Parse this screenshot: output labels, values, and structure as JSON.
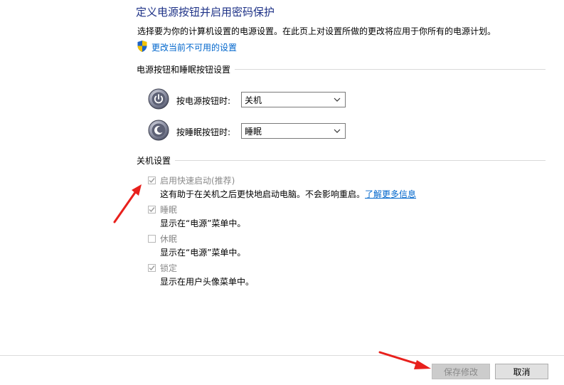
{
  "header": {
    "title": "定义电源按钮并启用密码保护",
    "description": "选择要为你的计算机设置的电源设置。在此页上对设置所做的更改将应用于你所有的电源计划。",
    "change_link": "更改当前不可用的设置",
    "shield_icon": "uac-shield-icon"
  },
  "power_section": {
    "title": "电源按钮和睡眠按钮设置",
    "rows": [
      {
        "label": "按电源按钮时:",
        "value": "关机",
        "icon": "power-button-icon"
      },
      {
        "label": "按睡眠按钮时:",
        "value": "睡眠",
        "icon": "sleep-button-icon"
      }
    ]
  },
  "shutdown_section": {
    "title": "关机设置",
    "items": [
      {
        "label": "启用快速启动(推荐)",
        "checked": true,
        "desc": "这有助于在关机之后更快地启动电脑。不会影响重启。",
        "link": "了解更多信息"
      },
      {
        "label": "睡眠",
        "checked": true,
        "desc": "显示在“电源”菜单中。"
      },
      {
        "label": "休眠",
        "checked": false,
        "desc": "显示在“电源”菜单中。"
      },
      {
        "label": "锁定",
        "checked": true,
        "desc": "显示在用户头像菜单中。"
      }
    ]
  },
  "footer": {
    "save_label": "保存修改",
    "cancel_label": "取消"
  },
  "colors": {
    "title": "#1e3287",
    "link": "#0066cc",
    "annotation_arrow": "#e8201c"
  }
}
